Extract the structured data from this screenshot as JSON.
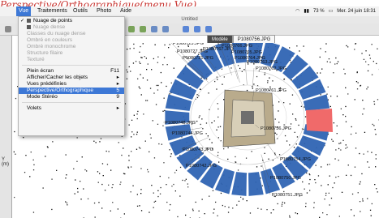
{
  "annotation": "Perspective/Orthographique(menu Vue)",
  "menubar": {
    "items": [
      "Vue",
      "Traitements",
      "Outils",
      "Photo",
      "Aide"
    ],
    "active": "Vue",
    "status_text": "73 %",
    "date_time": "Mer. 24 juin 18:31"
  },
  "window": {
    "title": "Untitled"
  },
  "tabs": [
    {
      "label": "Modèle",
      "selected": true
    },
    {
      "label": "P1080756.JPG",
      "selected": false
    }
  ],
  "left_panel": {
    "label": "Y (m)"
  },
  "menu": {
    "items": [
      {
        "label": "Nuage de points",
        "checked": true,
        "enabled": true,
        "shortcut": "",
        "submenu": false,
        "icon": "point-cloud-icon"
      },
      {
        "label": "Nuage dense",
        "checked": false,
        "enabled": false,
        "shortcut": "",
        "submenu": false,
        "icon": "dense-cloud-icon"
      },
      {
        "label": "Classes du nuage dense",
        "checked": false,
        "enabled": false,
        "shortcut": "",
        "submenu": false,
        "icon": ""
      },
      {
        "label": "Ombré en couleurs",
        "checked": false,
        "enabled": false,
        "shortcut": "",
        "submenu": false,
        "icon": ""
      },
      {
        "label": "Ombré monochrome",
        "checked": false,
        "enabled": false,
        "shortcut": "",
        "submenu": false,
        "icon": ""
      },
      {
        "label": "Structure filaire",
        "checked": false,
        "enabled": false,
        "shortcut": "",
        "submenu": false,
        "icon": ""
      },
      {
        "label": "Texturé",
        "checked": false,
        "enabled": false,
        "shortcut": "",
        "submenu": false,
        "icon": ""
      },
      {
        "label": "Plein écran",
        "checked": false,
        "enabled": true,
        "shortcut": "F11",
        "submenu": false,
        "icon": ""
      },
      {
        "label": "Afficher/Cacher les objets",
        "checked": false,
        "enabled": true,
        "shortcut": "",
        "submenu": true,
        "icon": ""
      },
      {
        "label": "Vues prédéfinies",
        "checked": false,
        "enabled": true,
        "shortcut": "",
        "submenu": true,
        "icon": ""
      },
      {
        "label": "Perspective/Orthographique",
        "checked": false,
        "enabled": true,
        "shortcut": "5",
        "submenu": false,
        "icon": "",
        "highlighted": true
      },
      {
        "label": "Mode Stéréo",
        "checked": false,
        "enabled": true,
        "shortcut": "9",
        "submenu": false,
        "icon": ""
      },
      {
        "label": "Volets",
        "checked": false,
        "enabled": true,
        "shortcut": "",
        "submenu": true,
        "icon": ""
      }
    ]
  },
  "camera_labels": [
    "P1080767.JPG",
    "P1080766.JPG",
    "P1080765.JPG",
    "P1080764.JPG",
    "P1080763.JPG",
    "P1080762.JPG",
    "P1080761.JPG",
    "P1080756.JPG",
    "P1080754.JPG",
    "P1080750.JPG",
    "P1080751.JPG",
    "P1080748.JPG",
    "P1080744.JPG",
    "P1080743.JPG",
    "P1080742.JPG",
    "P1080727.JPG",
    "P1080723.JPG",
    "P1080721.JPG"
  ],
  "selected_camera": "P1080756.JPG",
  "colors": {
    "camera": "#2f64b3",
    "selected_camera": "#f06a6a",
    "menu_highlight": "#3d78d6",
    "annotation": "#c8332f"
  }
}
